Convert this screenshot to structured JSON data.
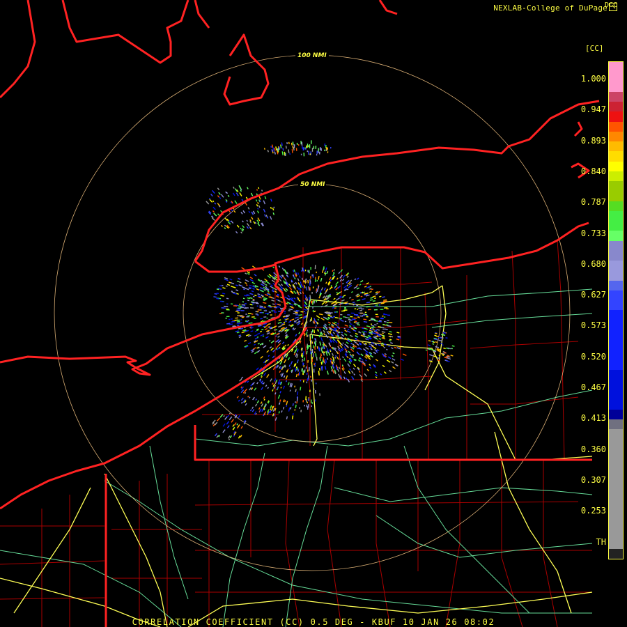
{
  "credit": "NEXLAB-College of DuPage",
  "credit_icon": "external-link-icon",
  "footer": "CORRELATION COEFFICIENT (CC) 0.5 DEG - KBUF 10 JAN 26 08:02",
  "range_rings": [
    "100 NMI",
    "50 NMI"
  ],
  "colors": {
    "state_border": "#ff2222",
    "county_border": "#aa0000",
    "interstate": "#ffff55",
    "highway": "#66dd99",
    "range_ring": "#ffcc88",
    "text": "#ffff44"
  },
  "color_scale": {
    "product": "DCC",
    "unit": "[CC]",
    "labels": [
      "1.000",
      "0.947",
      "0.893",
      "0.840",
      "0.787",
      "0.733",
      "0.680",
      "0.627",
      "0.573",
      "0.520",
      "0.467",
      "0.413",
      "0.360",
      "0.307",
      "0.253",
      "TH"
    ],
    "bands": [
      {
        "color": "#ff99cc",
        "weight": 3
      },
      {
        "color": "#cc4466",
        "weight": 1
      },
      {
        "color": "#cc2233",
        "weight": 1
      },
      {
        "color": "#ee1111",
        "weight": 1
      },
      {
        "color": "#ff5500",
        "weight": 1
      },
      {
        "color": "#ff8800",
        "weight": 1
      },
      {
        "color": "#ffbb00",
        "weight": 1
      },
      {
        "color": "#ffdd00",
        "weight": 1
      },
      {
        "color": "#ffff00",
        "weight": 1
      },
      {
        "color": "#ccee00",
        "weight": 1
      },
      {
        "color": "#99cc00",
        "weight": 2
      },
      {
        "color": "#55dd22",
        "weight": 1
      },
      {
        "color": "#44ee44",
        "weight": 2
      },
      {
        "color": "#66ff66",
        "weight": 1
      },
      {
        "color": "#8888cc",
        "weight": 2
      },
      {
        "color": "#9999dd",
        "weight": 2
      },
      {
        "color": "#5566ee",
        "weight": 1
      },
      {
        "color": "#3344ff",
        "weight": 2
      },
      {
        "color": "#1122ff",
        "weight": 6
      },
      {
        "color": "#0011dd",
        "weight": 4
      },
      {
        "color": "#000099",
        "weight": 1
      },
      {
        "color": "#707080",
        "weight": 1
      },
      {
        "color": "#999999",
        "weight": 12
      },
      {
        "color": "#222222",
        "weight": 1
      }
    ]
  }
}
